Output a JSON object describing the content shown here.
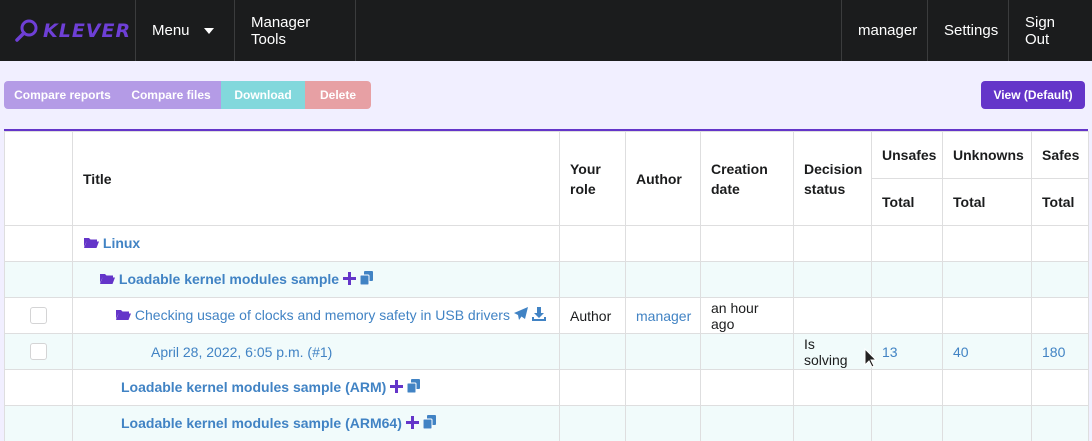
{
  "navbar": {
    "logo_text": "KLEVER",
    "menu_label": "Menu",
    "manager_tools_label": "Manager Tools",
    "user_label": "manager",
    "settings_label": "Settings",
    "signout_label": "Sign Out"
  },
  "toolbar": {
    "compare_reports_label": "Compare reports",
    "compare_files_label": "Compare files",
    "download_label": "Download",
    "delete_label": "Delete",
    "view_label": "View (Default)"
  },
  "table": {
    "headers": {
      "title": "Title",
      "your_role": "Your role",
      "author": "Author",
      "creation_date": "Creation date",
      "decision_status": "Decision status",
      "unsafes": "Unsafes",
      "unknowns": "Unknowns",
      "safes": "Safes",
      "total": "Total"
    },
    "rows": [
      {
        "title": "Linux"
      },
      {
        "title": "Loadable kernel modules sample"
      },
      {
        "title": "Checking usage of clocks and memory safety in USB drivers",
        "role": "Author",
        "author": "manager",
        "created": "an hour ago"
      },
      {
        "title": "April 28, 2022, 6:05 p.m. (#1)",
        "status": "Is solving",
        "unsafes": "13",
        "unknowns": "40",
        "safes": "180"
      },
      {
        "title": "Loadable kernel modules sample (ARM)"
      },
      {
        "title": "Loadable kernel modules sample (ARM64)"
      }
    ]
  },
  "colors": {
    "accent": "#6435c9",
    "link": "#4183c4",
    "navbar_bg": "#1b1c1d",
    "page_bg": "#f1efff"
  }
}
